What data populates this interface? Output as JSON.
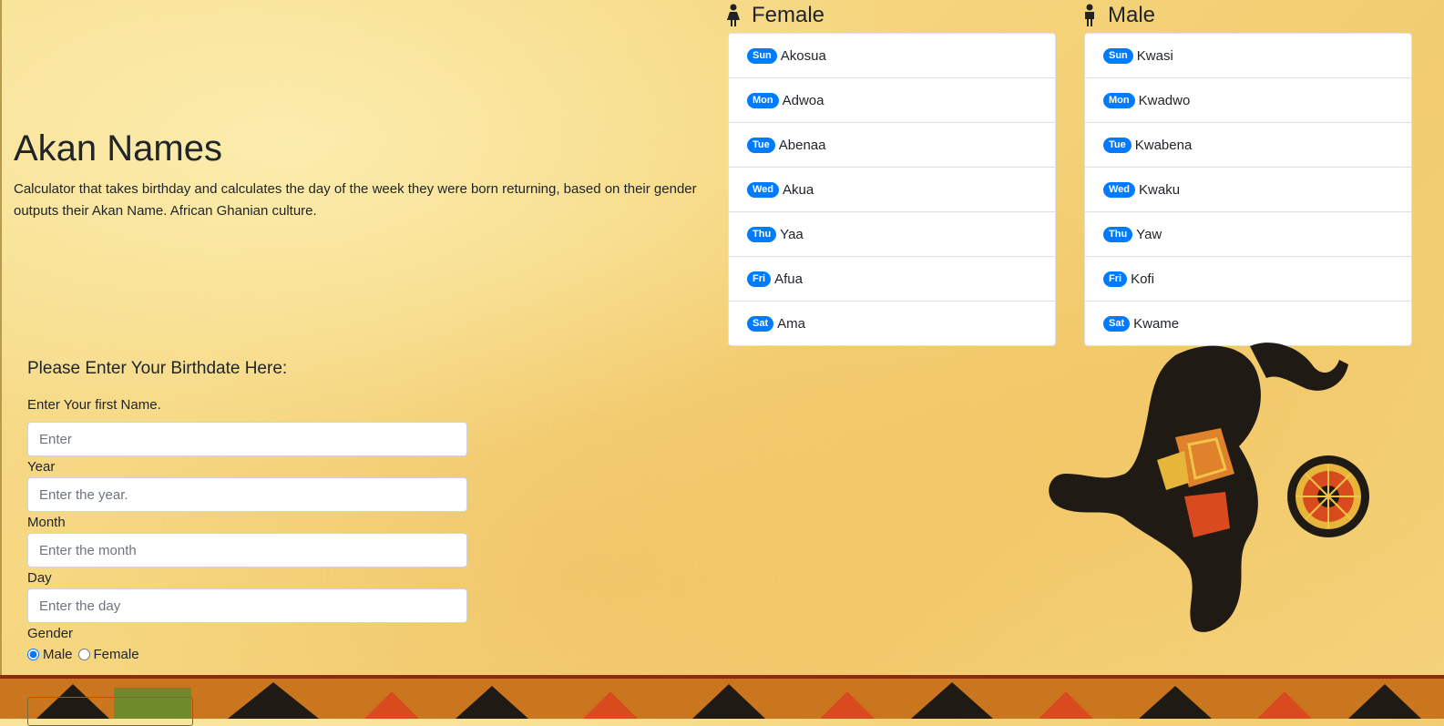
{
  "header": {
    "title": "Akan Names",
    "description": "Calculator that takes birthday and calculates the day of the week they were born returning, based on their gender outputs their Akan Name. African Ghanian culture."
  },
  "female": {
    "heading": "Female",
    "icon": "female-person-icon",
    "items": [
      {
        "day": "Sun",
        "name": "Akosua"
      },
      {
        "day": "Mon",
        "name": "Adwoa"
      },
      {
        "day": "Tue",
        "name": "Abenaa"
      },
      {
        "day": "Wed",
        "name": "Akua"
      },
      {
        "day": "Thu",
        "name": "Yaa"
      },
      {
        "day": "Fri",
        "name": "Afua"
      },
      {
        "day": "Sat",
        "name": "Ama"
      }
    ]
  },
  "male": {
    "heading": "Male",
    "icon": "male-person-icon",
    "items": [
      {
        "day": "Sun",
        "name": "Kwasi"
      },
      {
        "day": "Mon",
        "name": "Kwadwo"
      },
      {
        "day": "Tue",
        "name": "Kwabena"
      },
      {
        "day": "Wed",
        "name": "Kwaku"
      },
      {
        "day": "Thu",
        "name": "Yaw"
      },
      {
        "day": "Fri",
        "name": "Kofi"
      },
      {
        "day": "Sat",
        "name": "Kwame"
      }
    ]
  },
  "form": {
    "title": "Please Enter Your Birthdate Here:",
    "first_name_label": "Enter Your first Name.",
    "first_name_placeholder": "Enter",
    "year_label": "Year",
    "year_placeholder": "Enter the year.",
    "month_label": "Month",
    "month_placeholder": "Enter the month",
    "day_label": "Day",
    "day_placeholder": "Enter the day",
    "gender_label": "Gender",
    "gender_options": [
      "Male",
      "Female"
    ],
    "gender_selected": "Male"
  },
  "colors": {
    "badge": "#007bff",
    "background": "#f5d57d"
  }
}
